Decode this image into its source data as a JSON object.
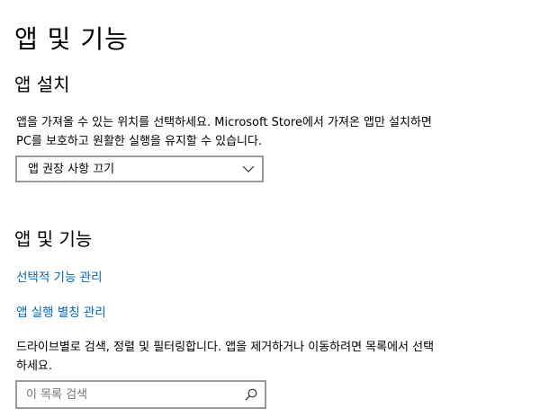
{
  "page": {
    "title": "앱 및 기능"
  },
  "install_section": {
    "title": "앱 설치",
    "description": "앱을 가져올 수 있는 위치를 선택하세요. Microsoft Store에서 가져온 앱만 설치하면 PC를 보호하고 원활한 실행을 유지할 수 있습니다.",
    "dropdown": {
      "selected": "앱 권장 사항 끄기",
      "icon": "chevron-down-icon"
    }
  },
  "apps_section": {
    "title": "앱 및 기능",
    "links": {
      "optional_features": "선택적 기능 관리",
      "execution_aliases": "앱 실행 별칭 관리"
    },
    "description": "드라이브별로 검색, 정렬 및 필터링합니다. 앱을 제거하거나 이동하려면 목록에서 선택하세요.",
    "search": {
      "placeholder": "이 목록 검색",
      "value": "",
      "icon": "search-icon"
    }
  },
  "colors": {
    "link": "#0067b8",
    "border": "#999999",
    "text": "#000000",
    "placeholder": "#767676"
  }
}
